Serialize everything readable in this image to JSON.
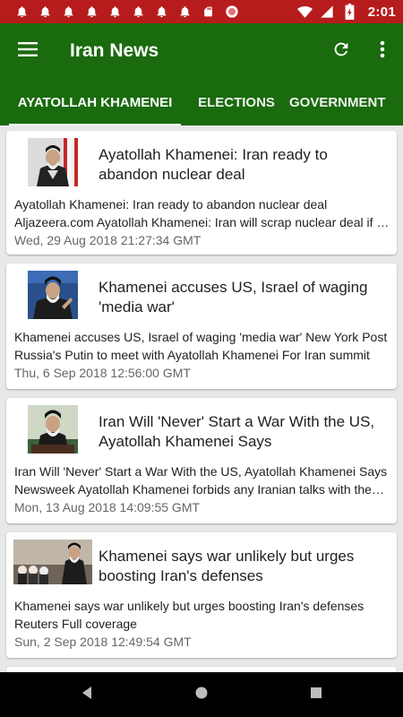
{
  "status_bar": {
    "time": "2:01",
    "notification_icons": [
      "bell-icon",
      "bell-icon",
      "bell-icon",
      "bell-icon",
      "bell-icon",
      "bell-icon",
      "bell-icon",
      "bell-icon",
      "sd-card-icon",
      "record-icon"
    ],
    "right_icons": [
      "wifi-icon",
      "signal-icon",
      "battery-charging-icon"
    ]
  },
  "app_bar": {
    "title": "Iran News",
    "menu_icon": "hamburger-icon",
    "refresh_icon": "refresh-icon",
    "overflow_icon": "more-vert-icon"
  },
  "tabs": [
    {
      "label": "AYATOLLAH KHAMENEI",
      "active": true
    },
    {
      "label": "ELECTIONS",
      "active": false
    },
    {
      "label": "GOVERNMENT",
      "active": false
    }
  ],
  "articles": [
    {
      "title": "Ayatollah Khamenei: Iran ready to abandon nuclear deal",
      "snippet": "Ayatollah Khamenei: Iran ready to abandon nuclear deal  Aljazeera.com  Ayatollah Khamenei: Iran will scrap nuclear deal if no longer in national interest",
      "date": "Wed, 29 Aug 2018 21:27:34 GMT"
    },
    {
      "title": "Khamenei accuses US, Israel of waging 'media war'",
      "snippet": "Khamenei accuses US, Israel of waging 'media war'  New York Post  Russia's Putin to meet with Ayatollah Khamenei For Iran summit",
      "date": "Thu, 6 Sep 2018 12:56:00 GMT"
    },
    {
      "title": "Iran Will 'Never' Start a War With the US, Ayatollah Khamenei Says",
      "snippet": "Iran Will 'Never' Start a War With the US, Ayatollah Khamenei Says  Newsweek  Ayatollah Khamenei forbids any Iranian talks with the US",
      "date": "Mon, 13 Aug 2018 14:09:55 GMT"
    },
    {
      "title": "Khamenei says war unlikely but urges boosting Iran's defenses",
      "snippet": "Khamenei says war unlikely but urges boosting Iran's defenses  Reuters  Full coverage",
      "date": "Sun, 2 Sep 2018 12:49:54 GMT"
    }
  ],
  "colors": {
    "status_bar": "#b71c1c",
    "app_bar": "#1a6a0e",
    "background": "#e8e8e8",
    "date_text": "#666666"
  },
  "nav_bar": {
    "icons": [
      "back-icon",
      "home-icon",
      "recents-icon"
    ]
  }
}
